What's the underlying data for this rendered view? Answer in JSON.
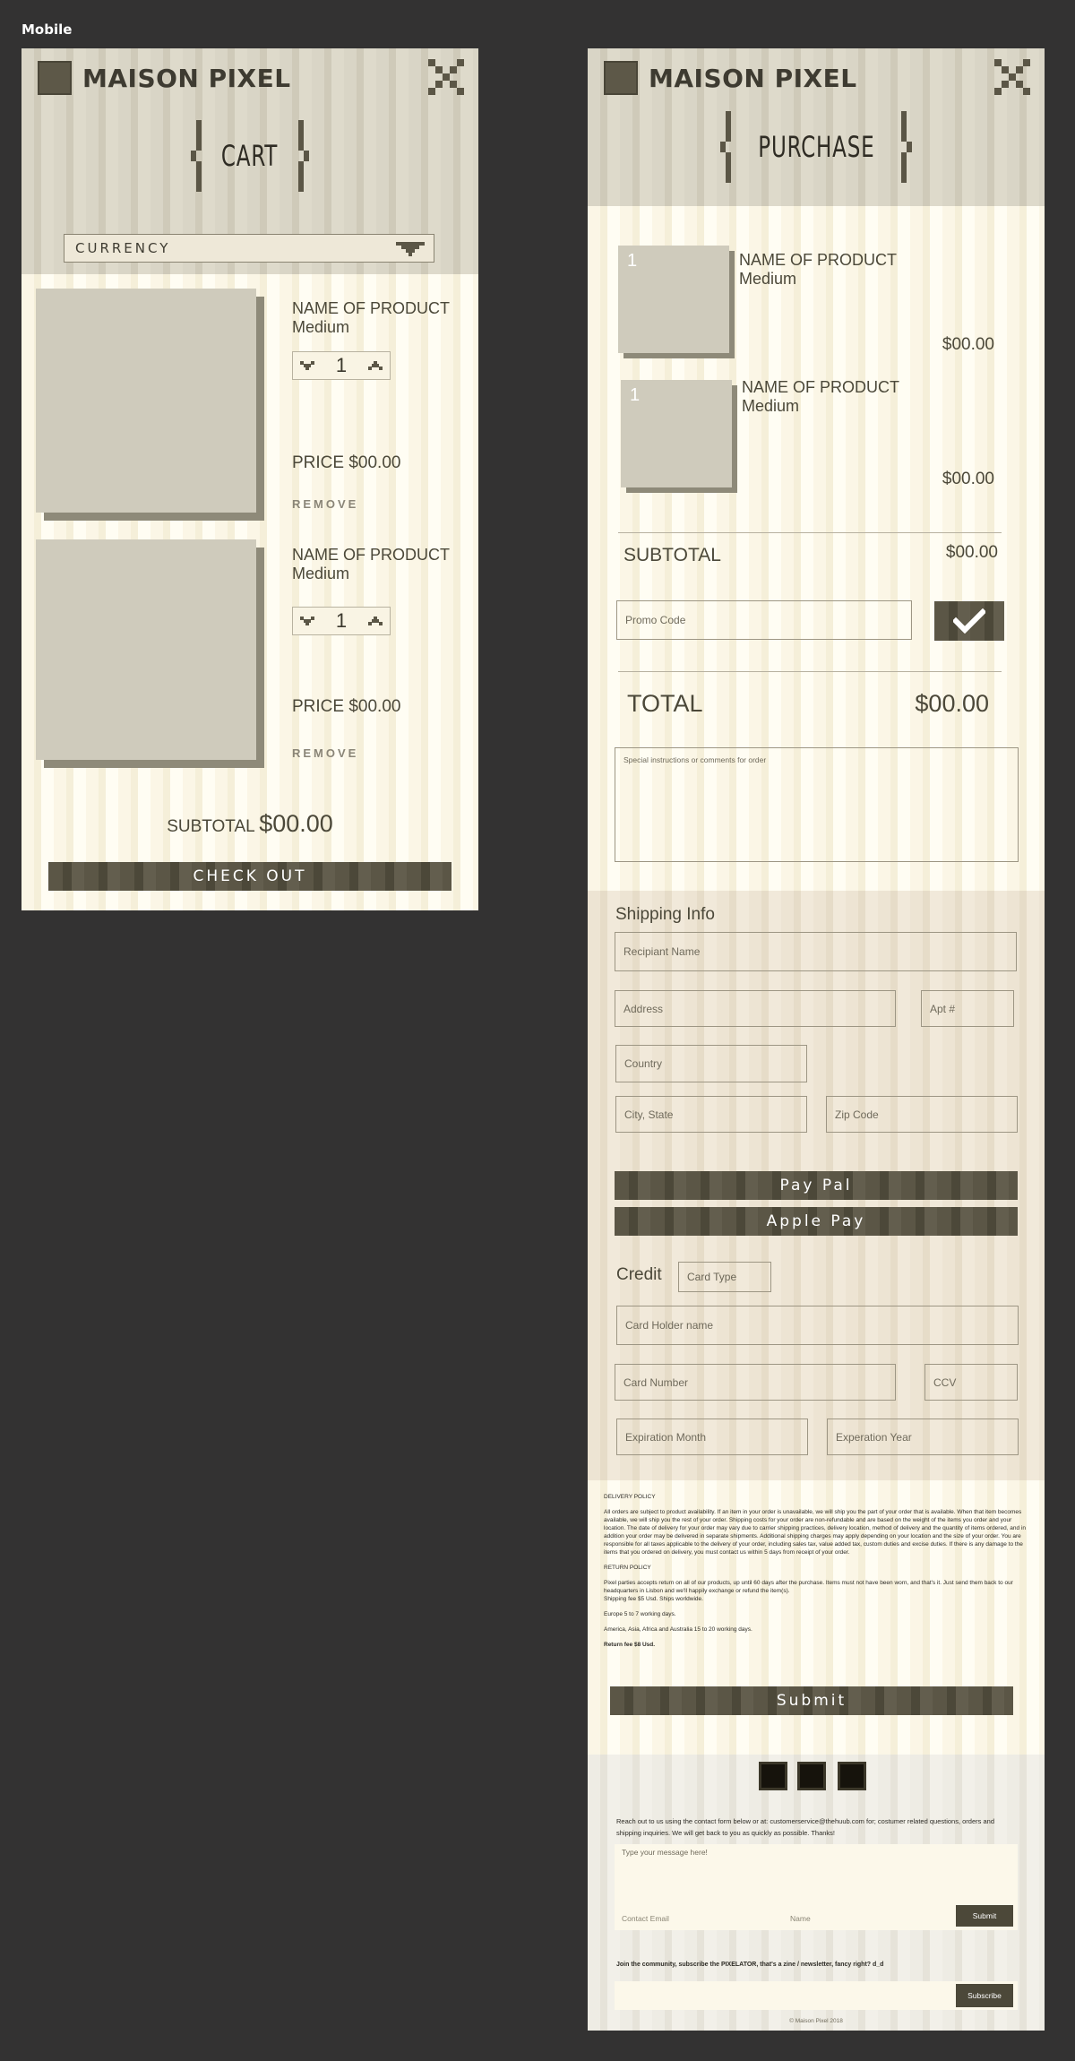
{
  "frame_label": "Mobile",
  "brand": {
    "name": "MAISON PIXEL"
  },
  "cart": {
    "title": "CART",
    "currency_label": "CURRENCY",
    "items": [
      {
        "name": "NAME OF PRODUCT",
        "size": "Medium",
        "qty": "1",
        "price": "PRICE $00.00",
        "remove": "REMOVE"
      },
      {
        "name": "NAME OF PRODUCT",
        "size": "Medium",
        "qty": "1",
        "price": "PRICE $00.00",
        "remove": "REMOVE"
      }
    ],
    "subtotal_label": "SUBTOTAL",
    "subtotal_value": "$00.00",
    "checkout_label": "CHECK OUT"
  },
  "purchase": {
    "title": "PURCHASE",
    "items": [
      {
        "qty": "1",
        "name": "NAME OF PRODUCT",
        "size": "Medium",
        "price": "$00.00"
      },
      {
        "qty": "1",
        "name": "NAME OF PRODUCT",
        "size": "Medium",
        "price": "$00.00"
      }
    ],
    "subtotal_label": "SUBTOTAL",
    "subtotal_value": "$00.00",
    "promo_placeholder": "Promo Code",
    "total_label": "TOTAL",
    "total_value": "$00.00",
    "instructions_placeholder": "Special instructions or comments for order",
    "shipping": {
      "heading": "Shipping Info",
      "recipient": "Recipiant Name",
      "address": "Address",
      "apt": "Apt #",
      "country": "Country",
      "city_state": "City, State",
      "zip": "Zip Code"
    },
    "paypal_label": "Pay Pal",
    "applepay_label": "Apple Pay",
    "credit": {
      "heading": "Credit",
      "card_type": "Card Type",
      "holder": "Card Holder name",
      "number": "Card Number",
      "ccv": "CCV",
      "exp_month": "Expiration Month",
      "exp_year": "Experation Year"
    },
    "policy": {
      "delivery_heading": "DELIVERY POLICY",
      "delivery_text": "All orders are subject to product availability. If an item in your order is unavailable, we will ship you the part of your order that is available. When that item becomes available, we will ship you the rest of your order. Shipping costs for your order are non-refundable and are based on the weight of the items you order and your location. The date of delivery for your order may vary due to carrier shipping practices, delivery location, method of delivery and the quantity of items ordered, and in addition your order may be delivered in separate shipments. Additional shipping charges may apply depending on your location and the size of your order. You are responsible for all taxes applicable to the delivery of your order, including sales tax, value added tax, custom duties and excise duties. If there is any damage to the items that you ordered on delivery, you must contact us within 5 days from receipt of your order.",
      "return_heading": "RETURN POLICY",
      "return_text": "Pixel parties accepts return on all of our products, up until 60 days after the purchase. Items must not have been worn, and that's it. Just send them back to our headquarters in Lisbon and we'll happily exchange or refund the item(s).",
      "shipping_fee": "Shipping fee $5 Usd. Ships worldwide.",
      "europe": "Europe 5 to 7 working days.",
      "americas": "America, Asia, Africa and Australia 15 to 20 working days.",
      "return_fee": "Return fee $8 Usd."
    },
    "submit_label": "Submit",
    "contact": {
      "text": "Reach out to us using the contact form below or at: customerservice@thehuub.com for; costumer related questions, orders and shipping inquiries. We will get back to you as quickly as possible. Thanks!",
      "message_placeholder": "Type your message here!",
      "email_placeholder": "Contact Email",
      "name_placeholder": "Name",
      "submit_label": "Submit",
      "newsletter_text": "Join the community, subscribe the PIXELATOR, that's a zine / newsletter, fancy right? d_d",
      "subscribe_label": "Subscribe",
      "copyright": "© Maison Pixel 2018"
    }
  },
  "colors": {
    "accent_dark": "#5b5646",
    "cream": "#fbf6e6",
    "header_gray": "#d9d5c6",
    "beige": "#ede4d3"
  }
}
